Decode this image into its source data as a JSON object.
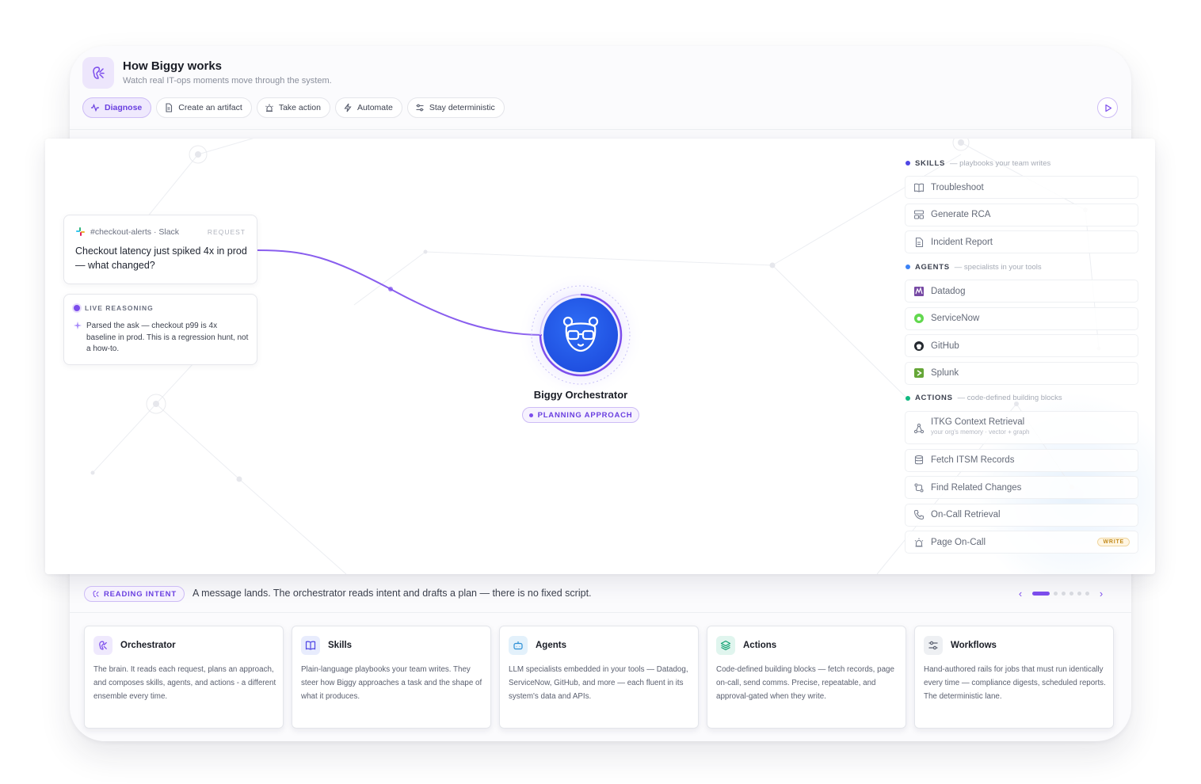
{
  "header": {
    "title": "How Biggy works",
    "subtitle": "Watch real IT-ops moments move through the system."
  },
  "tabs": [
    {
      "label": "Diagnose",
      "icon": "activity-icon",
      "active": true
    },
    {
      "label": "Create an artifact",
      "icon": "document-icon",
      "active": false
    },
    {
      "label": "Take action",
      "icon": "alarm-icon",
      "active": false
    },
    {
      "label": "Automate",
      "icon": "bolt-icon",
      "active": false
    },
    {
      "label": "Stay deterministic",
      "icon": "sliders-icon",
      "active": false
    }
  ],
  "request": {
    "source": "#checkout-alerts · Slack",
    "tag": "REQUEST",
    "message": "Checkout latency just spiked 4x in prod — what changed?"
  },
  "reasoning": {
    "heading": "LIVE REASONING",
    "body": "Parsed the ask — checkout p99 is 4x baseline in prod. This is a regression hunt, not a how-to."
  },
  "orchestrator": {
    "name": "Biggy Orchestrator",
    "badge": "PLANNING APPROACH"
  },
  "panel": {
    "skills": {
      "heading": "SKILLS",
      "desc": "— playbooks your team writes",
      "color": "#4f46e5",
      "items": [
        "Troubleshoot",
        "Generate RCA",
        "Incident Report"
      ]
    },
    "agents": {
      "heading": "AGENTS",
      "desc": "— specialists in your tools",
      "color": "#3b82f6",
      "items": [
        "Datadog",
        "ServiceNow",
        "GitHub",
        "Splunk"
      ]
    },
    "actions": {
      "heading": "ACTIONS",
      "desc": "— code-defined building blocks",
      "color": "#10b981",
      "items": [
        {
          "label": "ITKG Context Retrieval",
          "sub": "your org's memory · vector + graph"
        },
        {
          "label": "Fetch ITSM Records"
        },
        {
          "label": "Find Related Changes"
        },
        {
          "label": "On-Call Retrieval"
        },
        {
          "label": "Page On-Call",
          "badge": "WRITE"
        }
      ]
    }
  },
  "intent": {
    "pill": "READING INTENT",
    "text": "A message lands. The orchestrator reads intent and drafts a plan — there is no fixed script.",
    "page": 1,
    "pages": 6
  },
  "cards": [
    {
      "title": "Orchestrator",
      "text": "The brain. It reads each request, plans an approach, and composes skills, agents, and actions - a different ensemble every time.",
      "accent": "#efe9fd"
    },
    {
      "title": "Skills",
      "text": "Plain-language playbooks your team writes. They steer how Biggy approaches a task and the shape of what it produces.",
      "accent": "#e8ecfd"
    },
    {
      "title": "Agents",
      "text": "LLM specialists embedded in your tools — Datadog, ServiceNow, GitHub, and more — each fluent in its system's data and APIs.",
      "accent": "#e3f1fb"
    },
    {
      "title": "Actions",
      "text": "Code-defined building blocks — fetch records, page on-call, send comms. Precise, repeatable, and approval-gated when they write.",
      "accent": "#e0f5ee"
    },
    {
      "title": "Workflows",
      "text": "Hand-authored rails for jobs that must run identically every time — compliance digests, scheduled reports. The deterministic lane.",
      "accent": "#eef0f3"
    }
  ]
}
